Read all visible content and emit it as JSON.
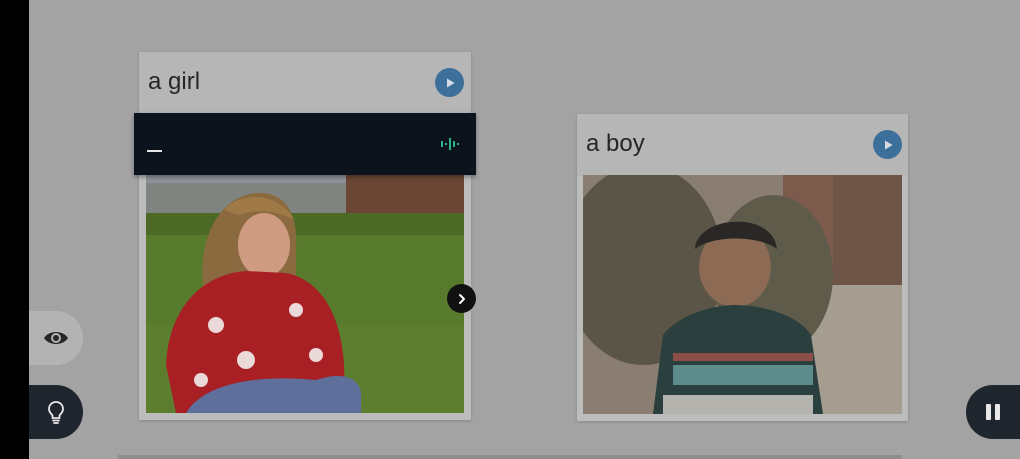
{
  "colors": {
    "background": "#a3a3a3",
    "play_button": "#3c6f9a",
    "overlay": "#0d131d",
    "wave_icon": "#2bb58b",
    "control_dark": "#20262e"
  },
  "cards": [
    {
      "title": "a girl",
      "play_icon": "play-icon",
      "image": "girl-photo"
    },
    {
      "title": "a boy",
      "play_icon": "play-icon",
      "image": "boy-photo"
    }
  ],
  "overlay": {
    "typed_text": "",
    "icon": "audio-wave-icon"
  },
  "controls": {
    "next_icon": "chevron-right-icon",
    "eye_icon": "eye-icon",
    "hint_icon": "lightbulb-icon",
    "pause_icon": "pause-icon"
  }
}
